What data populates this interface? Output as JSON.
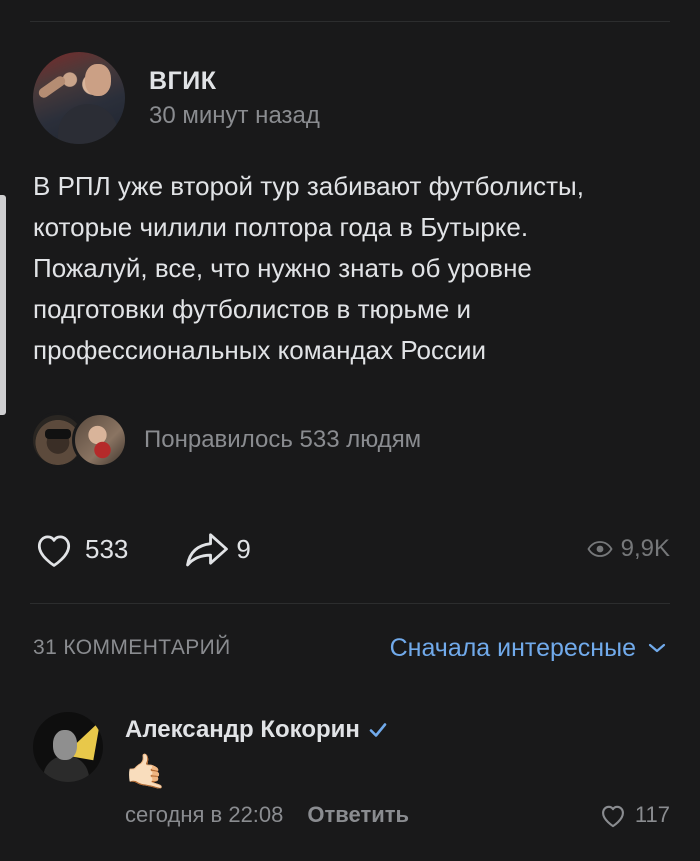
{
  "post": {
    "group_name": "ВГИК",
    "time": "30 минут назад",
    "text_lines": [
      "В РПЛ уже второй тур забивают футболисты,",
      "которые чилили полтора года в Бутырке.",
      "Пожалуй, все, что нужно знать об уровне",
      "подготовки футболистов в тюрьме и",
      "профессиональных командах России"
    ],
    "likers_text": "Понравилось 533 людям",
    "likes": "533",
    "shares": "9",
    "views": "9,9K"
  },
  "comments_header": {
    "count_label": "31 КОММЕНТАРИЙ",
    "sort_label": "Сначала интересные"
  },
  "comment": {
    "author": "Александр Кокорин",
    "content": "🤙🏻",
    "time": "сегодня в 22:08",
    "reply_label": "Ответить",
    "likes": "117"
  },
  "colors": {
    "background": "#19191a",
    "text": "#e1e3e6",
    "secondary": "#8a8c90",
    "accent": "#71aaeb"
  },
  "icons": {
    "like": "heart-icon",
    "share": "share-arrow-icon",
    "views": "eye-icon",
    "sort": "chevron-down-icon",
    "verified": "checkmark-icon"
  }
}
